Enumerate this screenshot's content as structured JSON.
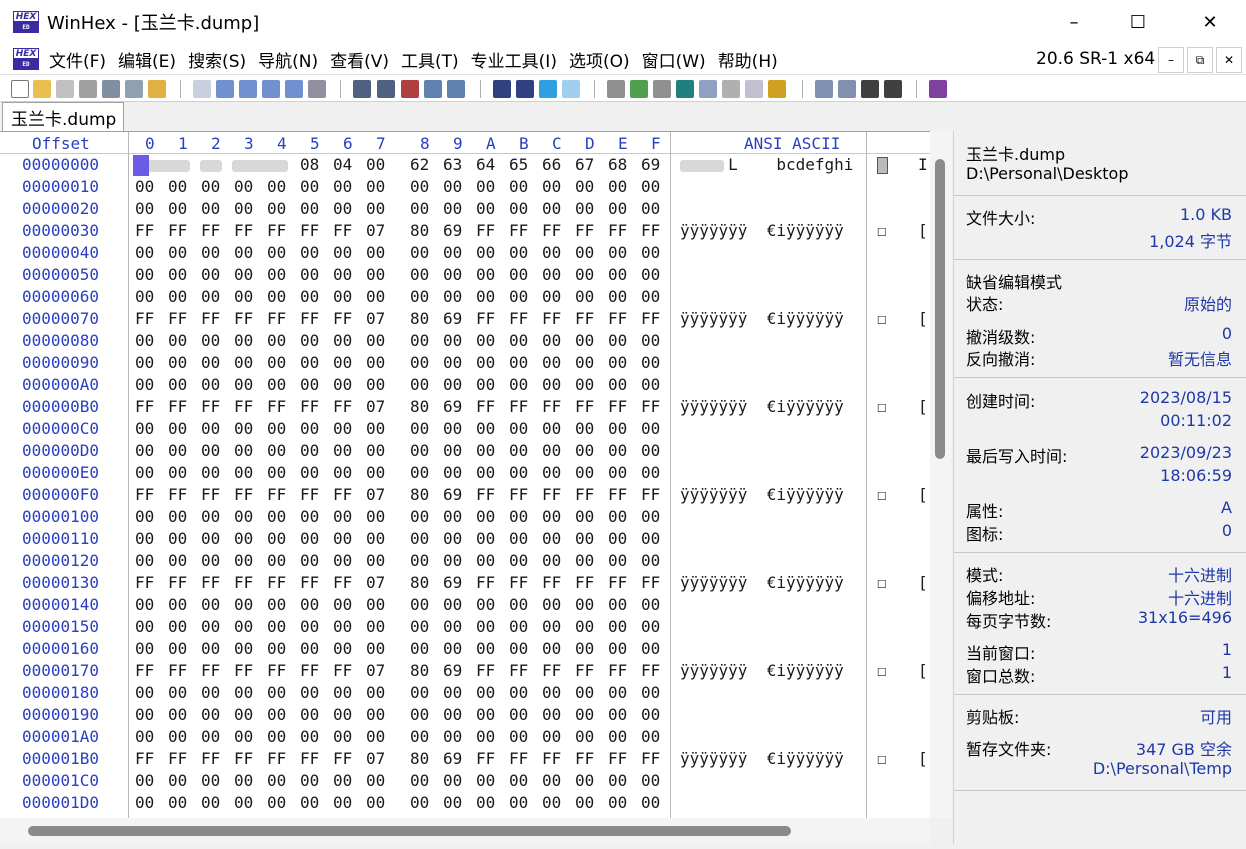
{
  "window": {
    "app_logo_top": "HEX",
    "app_logo_bottom": "ED",
    "title": "WinHex - [玉兰卡.dump]",
    "minimize": "–",
    "maximize": "☐",
    "close": "✕"
  },
  "menu": {
    "items": [
      "文件(F)",
      "编辑(E)",
      "搜索(S)",
      "导航(N)",
      "查看(V)",
      "工具(T)",
      "专业工具(I)",
      "选项(O)",
      "窗口(W)",
      "帮助(H)"
    ],
    "version": "20.6 SR-1 x64",
    "mdi_min": "–",
    "mdi_restore": "⧉",
    "mdi_close": "✕"
  },
  "tab": {
    "label": "玉兰卡.dump"
  },
  "hex": {
    "offset_header": "Offset",
    "columns": [
      "0",
      "1",
      "2",
      "3",
      "4",
      "5",
      "6",
      "7",
      "8",
      "9",
      "A",
      "B",
      "C",
      "D",
      "E",
      "F"
    ],
    "ansi_header": "ANSI ASCII",
    "rows": [
      {
        "offset": "00000000",
        "bytes": [
          "",
          "",
          "",
          "",
          "",
          "08",
          "04",
          "00",
          "62",
          "63",
          "64",
          "65",
          "66",
          "67",
          "68",
          "69"
        ],
        "ansi": "     L    bcdefghi",
        "sq1": "",
        "sq2": "I"
      },
      {
        "offset": "00000010",
        "bytes": [
          "00",
          "00",
          "00",
          "00",
          "00",
          "00",
          "00",
          "00",
          "00",
          "00",
          "00",
          "00",
          "00",
          "00",
          "00",
          "00"
        ],
        "ansi": "",
        "sq1": "",
        "sq2": ""
      },
      {
        "offset": "00000020",
        "bytes": [
          "00",
          "00",
          "00",
          "00",
          "00",
          "00",
          "00",
          "00",
          "00",
          "00",
          "00",
          "00",
          "00",
          "00",
          "00",
          "00"
        ],
        "ansi": "",
        "sq1": "",
        "sq2": ""
      },
      {
        "offset": "00000030",
        "bytes": [
          "FF",
          "FF",
          "FF",
          "FF",
          "FF",
          "FF",
          "FF",
          "07",
          "80",
          "69",
          "FF",
          "FF",
          "FF",
          "FF",
          "FF",
          "FF"
        ],
        "ansi": "ÿÿÿÿÿÿÿ  €iÿÿÿÿÿÿ",
        "sq1": "☐",
        "sq2": "[]"
      },
      {
        "offset": "00000040",
        "bytes": [
          "00",
          "00",
          "00",
          "00",
          "00",
          "00",
          "00",
          "00",
          "00",
          "00",
          "00",
          "00",
          "00",
          "00",
          "00",
          "00"
        ],
        "ansi": "",
        "sq1": "",
        "sq2": ""
      },
      {
        "offset": "00000050",
        "bytes": [
          "00",
          "00",
          "00",
          "00",
          "00",
          "00",
          "00",
          "00",
          "00",
          "00",
          "00",
          "00",
          "00",
          "00",
          "00",
          "00"
        ],
        "ansi": "",
        "sq1": "",
        "sq2": ""
      },
      {
        "offset": "00000060",
        "bytes": [
          "00",
          "00",
          "00",
          "00",
          "00",
          "00",
          "00",
          "00",
          "00",
          "00",
          "00",
          "00",
          "00",
          "00",
          "00",
          "00"
        ],
        "ansi": "",
        "sq1": "",
        "sq2": ""
      },
      {
        "offset": "00000070",
        "bytes": [
          "FF",
          "FF",
          "FF",
          "FF",
          "FF",
          "FF",
          "FF",
          "07",
          "80",
          "69",
          "FF",
          "FF",
          "FF",
          "FF",
          "FF",
          "FF"
        ],
        "ansi": "ÿÿÿÿÿÿÿ  €iÿÿÿÿÿÿ",
        "sq1": "☐",
        "sq2": "[]"
      },
      {
        "offset": "00000080",
        "bytes": [
          "00",
          "00",
          "00",
          "00",
          "00",
          "00",
          "00",
          "00",
          "00",
          "00",
          "00",
          "00",
          "00",
          "00",
          "00",
          "00"
        ],
        "ansi": "",
        "sq1": "",
        "sq2": ""
      },
      {
        "offset": "00000090",
        "bytes": [
          "00",
          "00",
          "00",
          "00",
          "00",
          "00",
          "00",
          "00",
          "00",
          "00",
          "00",
          "00",
          "00",
          "00",
          "00",
          "00"
        ],
        "ansi": "",
        "sq1": "",
        "sq2": ""
      },
      {
        "offset": "000000A0",
        "bytes": [
          "00",
          "00",
          "00",
          "00",
          "00",
          "00",
          "00",
          "00",
          "00",
          "00",
          "00",
          "00",
          "00",
          "00",
          "00",
          "00"
        ],
        "ansi": "",
        "sq1": "",
        "sq2": ""
      },
      {
        "offset": "000000B0",
        "bytes": [
          "FF",
          "FF",
          "FF",
          "FF",
          "FF",
          "FF",
          "FF",
          "07",
          "80",
          "69",
          "FF",
          "FF",
          "FF",
          "FF",
          "FF",
          "FF"
        ],
        "ansi": "ÿÿÿÿÿÿÿ  €iÿÿÿÿÿÿ",
        "sq1": "☐",
        "sq2": "[]"
      },
      {
        "offset": "000000C0",
        "bytes": [
          "00",
          "00",
          "00",
          "00",
          "00",
          "00",
          "00",
          "00",
          "00",
          "00",
          "00",
          "00",
          "00",
          "00",
          "00",
          "00"
        ],
        "ansi": "",
        "sq1": "",
        "sq2": ""
      },
      {
        "offset": "000000D0",
        "bytes": [
          "00",
          "00",
          "00",
          "00",
          "00",
          "00",
          "00",
          "00",
          "00",
          "00",
          "00",
          "00",
          "00",
          "00",
          "00",
          "00"
        ],
        "ansi": "",
        "sq1": "",
        "sq2": ""
      },
      {
        "offset": "000000E0",
        "bytes": [
          "00",
          "00",
          "00",
          "00",
          "00",
          "00",
          "00",
          "00",
          "00",
          "00",
          "00",
          "00",
          "00",
          "00",
          "00",
          "00"
        ],
        "ansi": "",
        "sq1": "",
        "sq2": ""
      },
      {
        "offset": "000000F0",
        "bytes": [
          "FF",
          "FF",
          "FF",
          "FF",
          "FF",
          "FF",
          "FF",
          "07",
          "80",
          "69",
          "FF",
          "FF",
          "FF",
          "FF",
          "FF",
          "FF"
        ],
        "ansi": "ÿÿÿÿÿÿÿ  €iÿÿÿÿÿÿ",
        "sq1": "☐",
        "sq2": "[]"
      },
      {
        "offset": "00000100",
        "bytes": [
          "00",
          "00",
          "00",
          "00",
          "00",
          "00",
          "00",
          "00",
          "00",
          "00",
          "00",
          "00",
          "00",
          "00",
          "00",
          "00"
        ],
        "ansi": "",
        "sq1": "",
        "sq2": ""
      },
      {
        "offset": "00000110",
        "bytes": [
          "00",
          "00",
          "00",
          "00",
          "00",
          "00",
          "00",
          "00",
          "00",
          "00",
          "00",
          "00",
          "00",
          "00",
          "00",
          "00"
        ],
        "ansi": "",
        "sq1": "",
        "sq2": ""
      },
      {
        "offset": "00000120",
        "bytes": [
          "00",
          "00",
          "00",
          "00",
          "00",
          "00",
          "00",
          "00",
          "00",
          "00",
          "00",
          "00",
          "00",
          "00",
          "00",
          "00"
        ],
        "ansi": "",
        "sq1": "",
        "sq2": ""
      },
      {
        "offset": "00000130",
        "bytes": [
          "FF",
          "FF",
          "FF",
          "FF",
          "FF",
          "FF",
          "FF",
          "07",
          "80",
          "69",
          "FF",
          "FF",
          "FF",
          "FF",
          "FF",
          "FF"
        ],
        "ansi": "ÿÿÿÿÿÿÿ  €iÿÿÿÿÿÿ",
        "sq1": "☐",
        "sq2": "[]"
      },
      {
        "offset": "00000140",
        "bytes": [
          "00",
          "00",
          "00",
          "00",
          "00",
          "00",
          "00",
          "00",
          "00",
          "00",
          "00",
          "00",
          "00",
          "00",
          "00",
          "00"
        ],
        "ansi": "",
        "sq1": "",
        "sq2": ""
      },
      {
        "offset": "00000150",
        "bytes": [
          "00",
          "00",
          "00",
          "00",
          "00",
          "00",
          "00",
          "00",
          "00",
          "00",
          "00",
          "00",
          "00",
          "00",
          "00",
          "00"
        ],
        "ansi": "",
        "sq1": "",
        "sq2": ""
      },
      {
        "offset": "00000160",
        "bytes": [
          "00",
          "00",
          "00",
          "00",
          "00",
          "00",
          "00",
          "00",
          "00",
          "00",
          "00",
          "00",
          "00",
          "00",
          "00",
          "00"
        ],
        "ansi": "",
        "sq1": "",
        "sq2": ""
      },
      {
        "offset": "00000170",
        "bytes": [
          "FF",
          "FF",
          "FF",
          "FF",
          "FF",
          "FF",
          "FF",
          "07",
          "80",
          "69",
          "FF",
          "FF",
          "FF",
          "FF",
          "FF",
          "FF"
        ],
        "ansi": "ÿÿÿÿÿÿÿ  €iÿÿÿÿÿÿ",
        "sq1": "☐",
        "sq2": "[]"
      },
      {
        "offset": "00000180",
        "bytes": [
          "00",
          "00",
          "00",
          "00",
          "00",
          "00",
          "00",
          "00",
          "00",
          "00",
          "00",
          "00",
          "00",
          "00",
          "00",
          "00"
        ],
        "ansi": "",
        "sq1": "",
        "sq2": ""
      },
      {
        "offset": "00000190",
        "bytes": [
          "00",
          "00",
          "00",
          "00",
          "00",
          "00",
          "00",
          "00",
          "00",
          "00",
          "00",
          "00",
          "00",
          "00",
          "00",
          "00"
        ],
        "ansi": "",
        "sq1": "",
        "sq2": ""
      },
      {
        "offset": "000001A0",
        "bytes": [
          "00",
          "00",
          "00",
          "00",
          "00",
          "00",
          "00",
          "00",
          "00",
          "00",
          "00",
          "00",
          "00",
          "00",
          "00",
          "00"
        ],
        "ansi": "",
        "sq1": "",
        "sq2": ""
      },
      {
        "offset": "000001B0",
        "bytes": [
          "FF",
          "FF",
          "FF",
          "FF",
          "FF",
          "FF",
          "FF",
          "07",
          "80",
          "69",
          "FF",
          "FF",
          "FF",
          "FF",
          "FF",
          "FF"
        ],
        "ansi": "ÿÿÿÿÿÿÿ  €iÿÿÿÿÿÿ",
        "sq1": "☐",
        "sq2": "[]"
      },
      {
        "offset": "000001C0",
        "bytes": [
          "00",
          "00",
          "00",
          "00",
          "00",
          "00",
          "00",
          "00",
          "00",
          "00",
          "00",
          "00",
          "00",
          "00",
          "00",
          "00"
        ],
        "ansi": "",
        "sq1": "",
        "sq2": ""
      },
      {
        "offset": "000001D0",
        "bytes": [
          "00",
          "00",
          "00",
          "00",
          "00",
          "00",
          "00",
          "00",
          "00",
          "00",
          "00",
          "00",
          "00",
          "00",
          "00",
          "00"
        ],
        "ansi": "",
        "sq1": "",
        "sq2": ""
      }
    ]
  },
  "info": {
    "filename": "玉兰卡.dump",
    "path": "D:\\Personal\\Desktop",
    "size_label": "文件大小:",
    "size_kb": "1.0 KB",
    "size_bytes": "1,024 字节",
    "edit_mode": "缺省编辑模式",
    "state_label": "状态:",
    "state_val": "原始的",
    "undo_label": "撤消级数:",
    "undo_val": "0",
    "redo_label": "反向撤消:",
    "redo_val": "暂无信息",
    "created_label": "创建时间:",
    "created_date": "2023/08/15",
    "created_time": "00:11:02",
    "modified_label": "最后写入时间:",
    "modified_date": "2023/09/23",
    "modified_time": "18:06:59",
    "attr_label": "属性:",
    "attr_val": "A",
    "icon_label": "图标:",
    "icon_val": "0",
    "mode_label": "模式:",
    "mode_val": "十六进制",
    "offaddr_label": "偏移地址:",
    "offaddr_val": "十六进制",
    "bpp_label": "每页字节数:",
    "bpp_val": "31x16=496",
    "curwin_label": "当前窗口:",
    "curwin_val": "1",
    "totalwin_label": "窗口总数:",
    "totalwin_val": "1",
    "clip_label": "剪贴板:",
    "clip_val": "可用",
    "temp_label": "暂存文件夹:",
    "temp_free": "347 GB 空余",
    "temp_path": "D:\\Personal\\Temp"
  },
  "colors": {
    "offset_blue": "#2a3fc0",
    "value_blue": "#1f38a8",
    "cursor": "#5040e0"
  }
}
